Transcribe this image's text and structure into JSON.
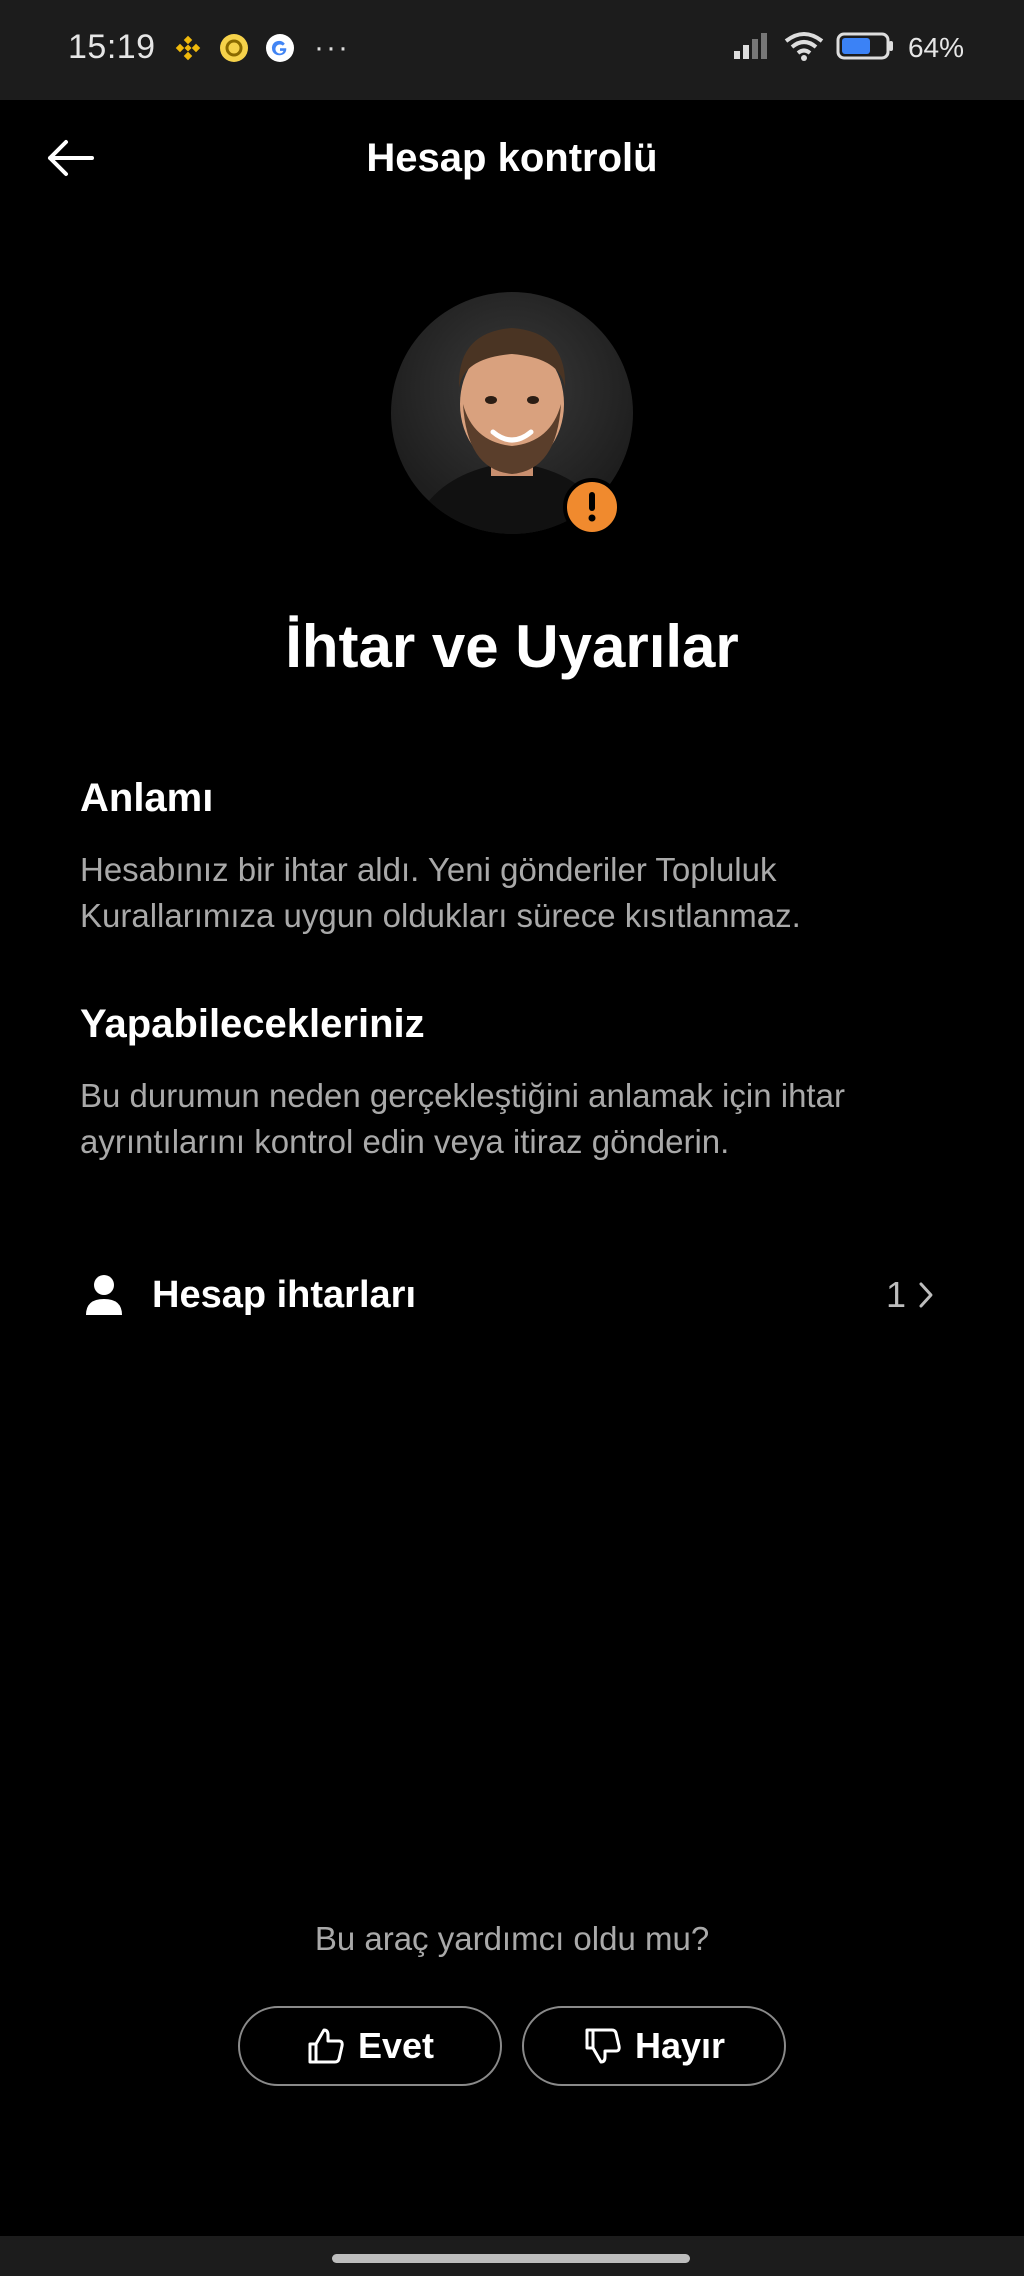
{
  "status_bar": {
    "time": "15:19",
    "app_icons": [
      "binance-icon",
      "coin-app-icon",
      "google-icon"
    ],
    "more": "···",
    "battery_percent": "64%"
  },
  "header": {
    "title": "Hesap kontrolü",
    "back_icon": "arrow-left-icon"
  },
  "profile": {
    "avatar": "profile-photo",
    "badge_icon": "exclamation-icon",
    "badge_color": "#f08a2e"
  },
  "page": {
    "title": "İhtar ve Uyarılar"
  },
  "sections": [
    {
      "heading": "Anlamı",
      "body": "Hesabınız bir ihtar aldı. Yeni gönderiler Topluluk Kurallarımıza uygun oldukları sürece kısıtlanmaz."
    },
    {
      "heading": "Yapabilecekleriniz",
      "body": "Bu durumun neden gerçekleştiğini anlamak için ihtar ayrıntılarını kontrol edin veya itiraz gönderin."
    }
  ],
  "list": {
    "item": {
      "icon": "person-icon",
      "label": "Hesap ihtarları",
      "count": "1"
    }
  },
  "feedback": {
    "question": "Bu araç yardımcı oldu mu?",
    "yes_label": "Evet",
    "no_label": "Hayır"
  }
}
